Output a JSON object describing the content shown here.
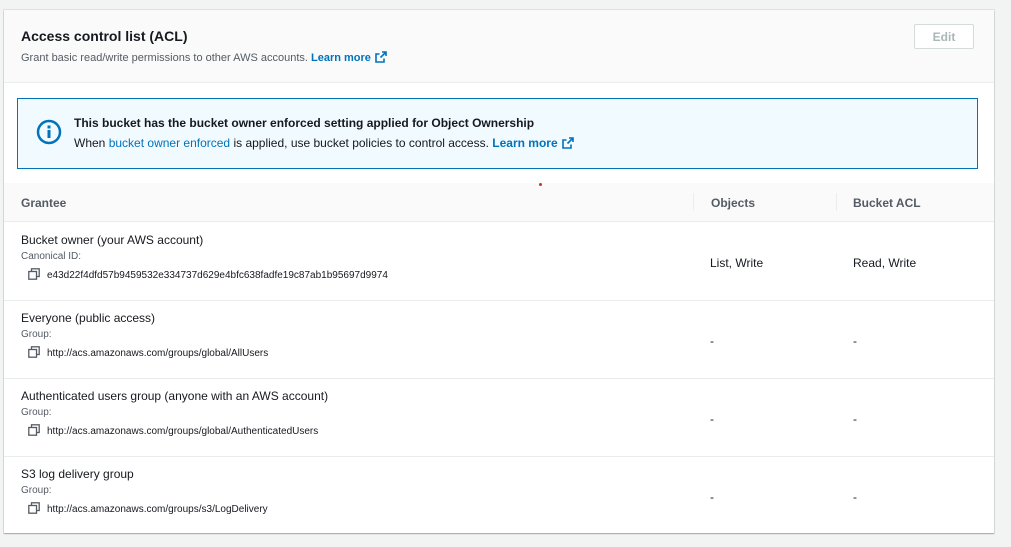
{
  "section": {
    "title": "Access control list (ACL)",
    "description": "Grant basic read/write permissions to other AWS accounts.",
    "learn_more": "Learn more",
    "edit_label": "Edit"
  },
  "alert": {
    "title": "This bucket has the bucket owner enforced setting applied for Object Ownership",
    "text_prefix": "When",
    "text_link": "bucket owner enforced",
    "text_suffix": "is applied, use bucket policies to control access.",
    "learn_more": "Learn more"
  },
  "table": {
    "columns": [
      "Grantee",
      "Objects",
      "Bucket ACL"
    ],
    "rows": [
      {
        "name": "Bucket owner (your AWS account)",
        "sub_label": "Canonical ID:",
        "id": "e43d22f4dfd57b9459532e334737d629e4bfc638fadfe19c87ab1b95697d9974",
        "objects": "List, Write",
        "bucket_acl": "Read, Write"
      },
      {
        "name": "Everyone (public access)",
        "sub_label": "Group:",
        "id": "http://acs.amazonaws.com/groups/global/AllUsers",
        "objects": "-",
        "bucket_acl": "-"
      },
      {
        "name": "Authenticated users group (anyone with an AWS account)",
        "sub_label": "Group:",
        "id": "http://acs.amazonaws.com/groups/global/AuthenticatedUsers",
        "objects": "-",
        "bucket_acl": "-"
      },
      {
        "name": "S3 log delivery group",
        "sub_label": "Group:",
        "id": "http://acs.amazonaws.com/groups/s3/LogDelivery",
        "objects": "-",
        "bucket_acl": "-"
      }
    ]
  },
  "colors": {
    "link": "#0073bb",
    "alert_border": "#0073bb",
    "alert_bg": "#f1faff",
    "marker_dot": "#d13212"
  }
}
